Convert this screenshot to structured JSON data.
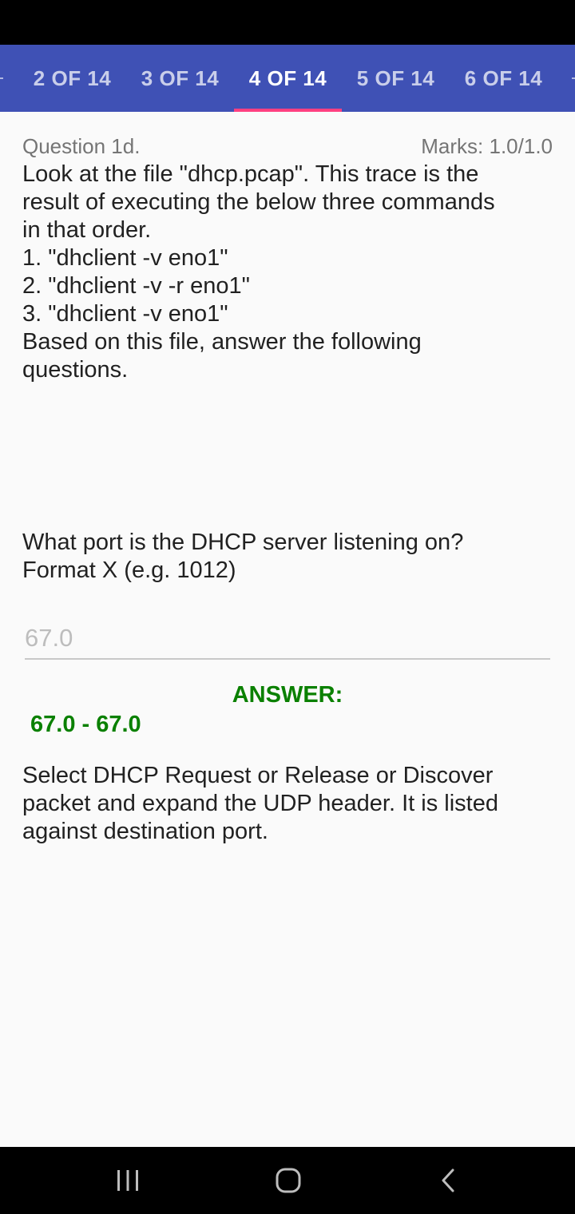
{
  "tabs": [
    {
      "label": "2 OF 14",
      "active": false
    },
    {
      "label": "3 OF 14",
      "active": false
    },
    {
      "label": "4 OF 14",
      "active": true
    },
    {
      "label": "5 OF 14",
      "active": false
    },
    {
      "label": "6 OF 14",
      "active": false
    }
  ],
  "question": {
    "label": "Question 1d.",
    "marks": "Marks: 1.0/1.0",
    "lines": [
      "Look at the file \"dhcp.pcap\". This trace is the",
      "result of executing the below three commands",
      "in that order.",
      "1. \"dhclient -v eno1\"",
      "2. \"dhclient -v -r eno1\"",
      "3. \"dhclient -v eno1\"",
      "Based on this file, answer the following",
      "questions."
    ],
    "prompt_lines": [
      "What port is the DHCP server listening on?",
      "Format X (e.g. 1012)"
    ]
  },
  "answer_input": {
    "value": "67.0"
  },
  "answer": {
    "heading": "ANSWER:",
    "range": "67.0 - 67.0"
  },
  "explanation_lines": [
    "Select DHCP Request or Release or Discover",
    "packet and expand the UDP header. It is listed",
    "against destination port."
  ],
  "colors": {
    "tab_bar": "#3f51b5",
    "tab_indicator": "#ff4081",
    "answer_green": "#0a8000"
  },
  "icons": {
    "nav_recents": "recents-icon",
    "nav_home": "home-icon",
    "nav_back": "back-icon"
  }
}
